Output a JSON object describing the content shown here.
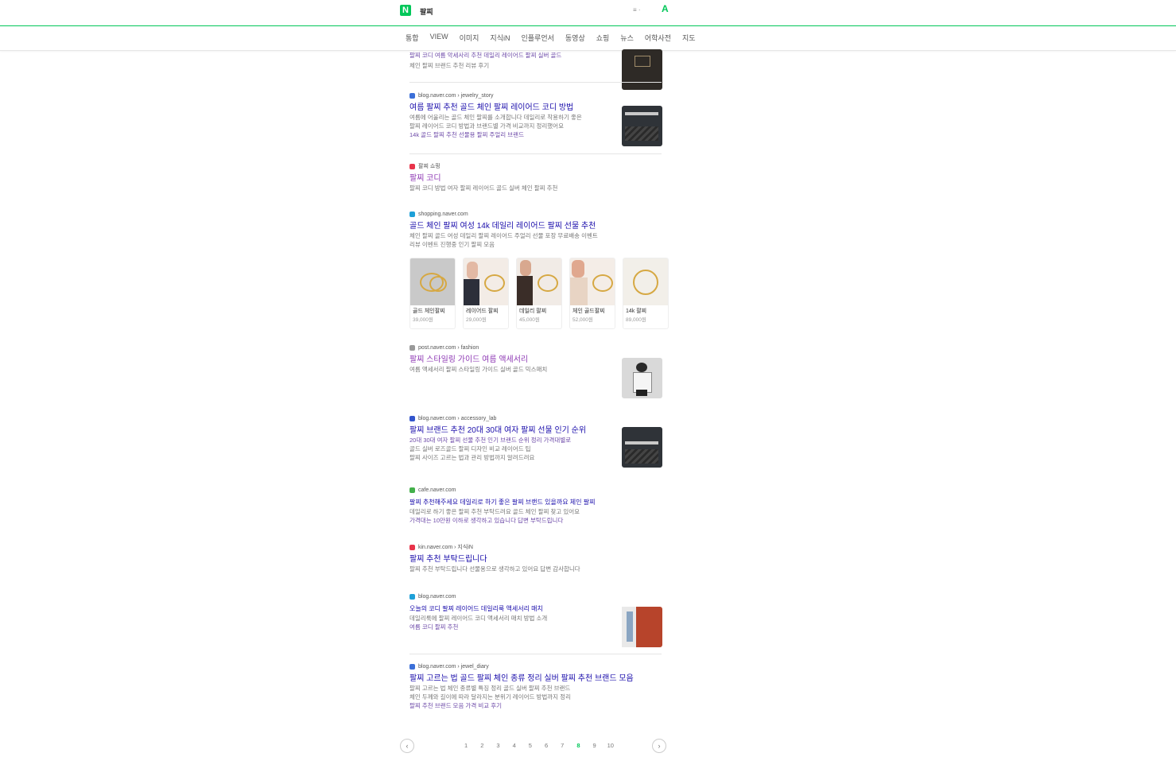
{
  "header": {
    "logo": "N",
    "query": "팔찌",
    "right_text": "≡ ·",
    "right_icon": "A"
  },
  "tabs": [
    "통합",
    "VIEW",
    "이미지",
    "지식iN",
    "인플루언서",
    "동영상",
    "쇼핑",
    "뉴스",
    "어학사전",
    "지도"
  ],
  "results": [
    {
      "source": "",
      "title": "",
      "desc": [
        "팔찌 코디 여름 악세사리 추천 데일리 레이어드 팔찌 실버 골드",
        "체인 팔찌 브랜드 추천 리뷰 후기"
      ],
      "fav_color": "#888888"
    },
    {
      "source": "blog.naver.com › jewelry_story",
      "title": "여름 팔찌 추천 골드 체인 팔찌 레이어드 코디 방법",
      "desc": [
        "여름에 어울리는 골드 체인 팔찌를 소개합니다 데일리로 착용하기 좋은",
        "팔찌 레이어드 코디 방법과 브랜드별 가격 비교까지 정리했어요",
        "14k 골드 팔찌 추천 선물용 팔찌 주얼리 브랜드"
      ],
      "fav_color": "#3b6fd8"
    },
    {
      "source": "팔찌 쇼핑",
      "title": "팔찌 코디",
      "desc": [
        "팔찌 코디 방법 여자 팔찌 레이어드 골드 실버 체인 팔찌 추천"
      ],
      "fav_color": "#e8334a"
    },
    {
      "source": "shopping.naver.com",
      "title": "골드 체인 팔찌 여성 14k 데일리 레이어드 팔찌 선물 추천",
      "desc": [
        "체인 팔찌 골드 여성 데일리 팔찌 레이어드 주얼리 선물 포장 무료배송 이벤트",
        "리뷰 이벤트 진행중 인기 팔찌 모음"
      ],
      "fav_color": "#1ea0d8"
    },
    {
      "source": "post.naver.com › fashion",
      "title": "팔찌 스타일링 가이드 여름 액세서리",
      "desc": [
        "여름 액세서리 팔찌 스타일링 가이드 실버 골드 믹스매치"
      ],
      "fav_color": "#999999"
    },
    {
      "source": "blog.naver.com › accessory_lab",
      "title": "팔찌 브랜드 추천 20대 30대 여자 팔찌 선물 인기 순위",
      "desc": [
        "20대 30대 여자 팔찌 선물 추천 인기 브랜드 순위 정리 가격대별로",
        "골드 실버 로즈골드 팔찌 디자인 비교 레이어드 팁",
        "팔찌 사이즈 고르는 법과 관리 방법까지 알려드려요"
      ],
      "fav_color": "#3355cc"
    },
    {
      "source": "cafe.naver.com",
      "title": "팔찌 추천해주세요 데일리로 하기 좋은 팔찌 브랜드 있을까요 체인 팔찌",
      "desc": [
        "데일리로 하기 좋은 팔찌 추천 부탁드려요 골드 체인 팔찌 찾고 있어요",
        "가격대는 10만원 이하로 생각하고 있습니다 답변 부탁드립니다"
      ],
      "fav_color": "#43b04a"
    },
    {
      "source": "kin.naver.com › 지식iN",
      "title": "팔찌 추천 부탁드립니다",
      "desc": [
        "팔찌 추천 부탁드립니다 선물용으로 생각하고 있어요 답변 감사합니다"
      ],
      "fav_color": "#e8334a"
    },
    {
      "source": "blog.naver.com",
      "title": "오늘의 코디 팔찌 레이어드 데일리룩 액세서리 매치",
      "desc": [
        "데일리룩에 팔찌 레이어드 코디 액세서리 매치 방법 소개",
        "여름 코디 팔찌 추천"
      ],
      "fav_color": "#1ea0d8"
    },
    {
      "source": "blog.naver.com › jewel_diary",
      "title": "팔찌 고르는 법 골드 팔찌 체인 종류 정리 실버 팔찌 추천 브랜드 모음",
      "desc": [
        "팔찌 고르는 법 체인 종류별 특징 정리 골드 실버 팔찌 추천 브랜드",
        "체인 두께와 길이에 따라 달라지는 분위기 레이어드 방법까지 정리",
        "팔찌 추천 브랜드 모음 가격 비교 후기"
      ],
      "fav_color": "#3b6fd8"
    }
  ],
  "products": [
    {
      "name": "골드 체인팔찌",
      "price": "39,000원"
    },
    {
      "name": "레이어드 팔찌",
      "price": "29,000원"
    },
    {
      "name": "데일리 팔찌",
      "price": "45,000원"
    },
    {
      "name": "체인 골드팔찌",
      "price": "52,000원"
    },
    {
      "name": "14k 팔찌",
      "price": "89,000원"
    }
  ],
  "pagination": {
    "prev": "‹",
    "next": "›",
    "pages": [
      "1",
      "2",
      "3",
      "4",
      "5",
      "6",
      "7",
      "8",
      "9",
      "10"
    ],
    "current": "8"
  },
  "colors": {
    "brand": "#03c75a",
    "link": "#1a0dab",
    "visited": "#8f3ab5"
  }
}
